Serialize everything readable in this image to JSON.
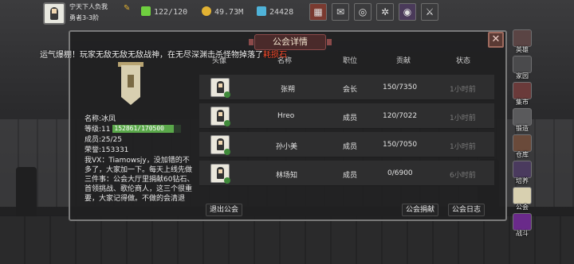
{
  "player": {
    "name": "宁天下人负我",
    "rank": "勇者3-3阶"
  },
  "resources": {
    "energy": "122/120",
    "gold": "49.73M",
    "gems": "24428"
  },
  "broadcast": {
    "text": "运气爆棚！玩家无敌无敌无敌战神，在无尽深渊击杀怪物掉落了",
    "highlight": "耗损石"
  },
  "side_menu": [
    {
      "label": "英雄",
      "icon": "helmet-icon"
    },
    {
      "label": "家园",
      "icon": "house-icon"
    },
    {
      "label": "集市",
      "icon": "market-icon"
    },
    {
      "label": "锻造",
      "icon": "anvil-icon"
    },
    {
      "label": "仓库",
      "icon": "chest-icon"
    },
    {
      "label": "培养",
      "icon": "potion-icon"
    },
    {
      "label": "公会",
      "icon": "guild-icon"
    },
    {
      "label": "战斗",
      "icon": "portal-icon"
    }
  ],
  "panel": {
    "title": "公会详情",
    "close": "✕"
  },
  "guild": {
    "name_label": "名称:",
    "name": "冰凤",
    "level_label": "等级:",
    "level": "11",
    "exp_text": "152861/170500",
    "exp_fraction": 0.8965,
    "members_label": "成员:",
    "members": "25/25",
    "honor_label": "荣誉:",
    "honor": "153331",
    "notice": "我VX：Tiamowsjy，没加错的不多了，大家加一下。每天上线先做三件事：公会大厅里捐献60钻石、首领挑战、歌伦商人，这三个很重要，大家记得做。不做的会清退"
  },
  "table": {
    "headers": {
      "avatar": "头像",
      "name": "名称",
      "role": "职位",
      "contribution": "贡献",
      "status": "状态"
    },
    "rows": [
      {
        "name": "张朔",
        "role": "会长",
        "contribution": "150/7350",
        "status": "1小时前"
      },
      {
        "name": "Hreo",
        "role": "成员",
        "contribution": "120/7022",
        "status": "1小时前"
      },
      {
        "name": "孙小美",
        "role": "成员",
        "contribution": "150/7050",
        "status": "1小时前"
      },
      {
        "name": "林场知",
        "role": "成员",
        "contribution": "0/6900",
        "status": "6小时前"
      }
    ]
  },
  "buttons": {
    "leave": "退出公会",
    "donate": "公会捐献",
    "log": "公会日志"
  },
  "colors": {
    "highlight_red": "#ff4e2e",
    "exp_green": "#5aa84a"
  }
}
